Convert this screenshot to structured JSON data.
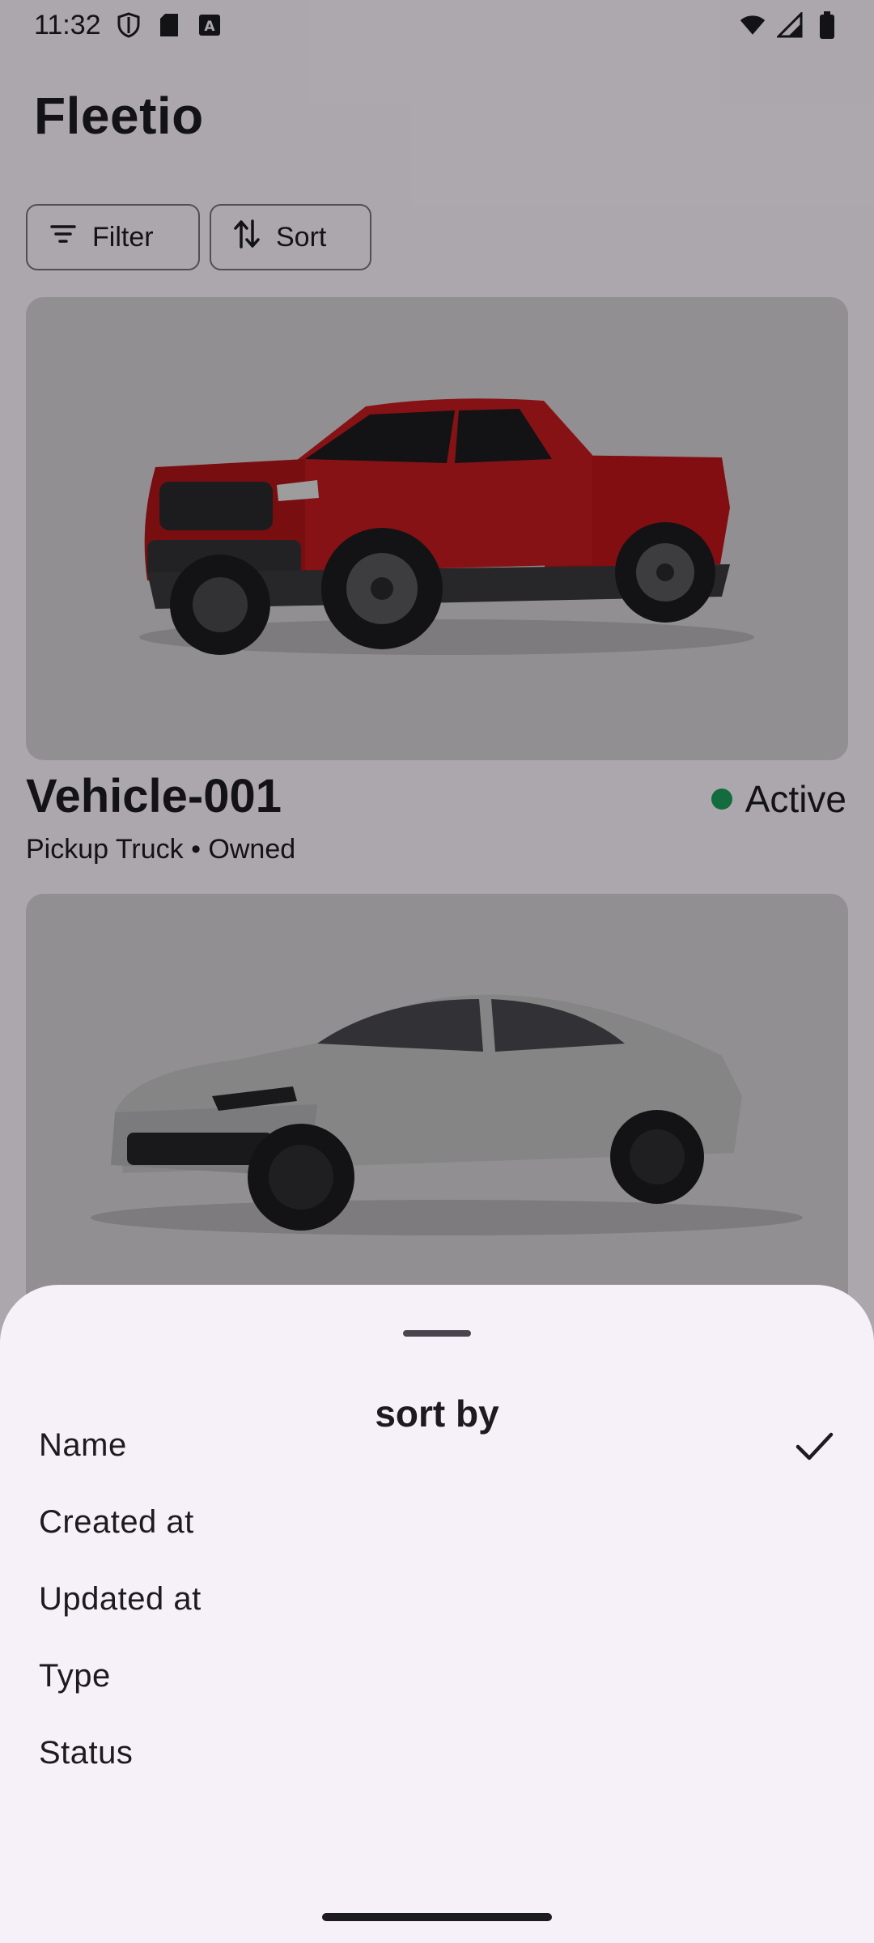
{
  "status_bar": {
    "time": "11:32",
    "icons": [
      "shield-icon",
      "sd-card-icon",
      "a-letter-icon",
      "wifi-icon",
      "signal-icon",
      "battery-icon"
    ]
  },
  "app": {
    "title": "Fleetio"
  },
  "toolbar": {
    "filter_label": "Filter",
    "sort_label": "Sort"
  },
  "vehicles": [
    {
      "name": "Vehicle-001",
      "subtitle": "Pickup Truck • Owned",
      "status": "Active",
      "status_color": "#1ba05a",
      "image": "red-pickup-truck"
    },
    {
      "image": "gray-sedan"
    }
  ],
  "sort_sheet": {
    "title": "sort by",
    "options": [
      {
        "label": "Name",
        "selected": true
      },
      {
        "label": "Created at",
        "selected": false
      },
      {
        "label": "Updated at",
        "selected": false
      },
      {
        "label": "Type",
        "selected": false
      },
      {
        "label": "Status",
        "selected": false
      }
    ]
  },
  "colors": {
    "scrim": "rgba(0,0,0,0.32)",
    "sheet_background": "#f6f1f8",
    "active_dot": "#1ba05a"
  }
}
